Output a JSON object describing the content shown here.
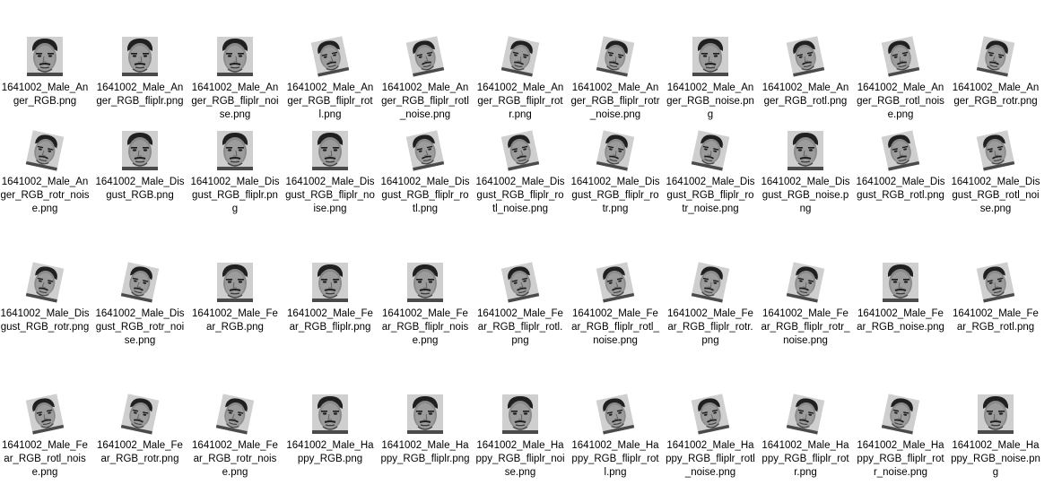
{
  "window": {
    "view": "Large icons"
  },
  "files": [
    {
      "name": "1641002_Male_Anger_RGB.png",
      "transform": "none"
    },
    {
      "name": "1641002_Male_Anger_RGB_fliplr.png",
      "transform": "fliplr"
    },
    {
      "name": "1641002_Male_Anger_RGB_fliplr_noise.png",
      "transform": "fliplr"
    },
    {
      "name": "1641002_Male_Anger_RGB_fliplr_rotl.png",
      "transform": "fliplr_rotl"
    },
    {
      "name": "1641002_Male_Anger_RGB_fliplr_rotl_noise.png",
      "transform": "fliplr_rotl"
    },
    {
      "name": "1641002_Male_Anger_RGB_fliplr_rotr.png",
      "transform": "fliplr_rotr"
    },
    {
      "name": "1641002_Male_Anger_RGB_fliplr_rotr_noise.png",
      "transform": "fliplr_rotr"
    },
    {
      "name": "1641002_Male_Anger_RGB_noise.png",
      "transform": "none"
    },
    {
      "name": "1641002_Male_Anger_RGB_rotl.png",
      "transform": "rotl"
    },
    {
      "name": "1641002_Male_Anger_RGB_rotl_noise.png",
      "transform": "rotl"
    },
    {
      "name": "1641002_Male_Anger_RGB_rotr.png",
      "transform": "rotr"
    },
    {
      "name": "1641002_Male_Anger_RGB_rotr_noise.png",
      "transform": "rotr"
    },
    {
      "name": "1641002_Male_Disgust_RGB.png",
      "transform": "none"
    },
    {
      "name": "1641002_Male_Disgust_RGB_fliplr.png",
      "transform": "fliplr"
    },
    {
      "name": "1641002_Male_Disgust_RGB_fliplr_noise.png",
      "transform": "fliplr"
    },
    {
      "name": "1641002_Male_Disgust_RGB_fliplr_rotl.png",
      "transform": "fliplr_rotl"
    },
    {
      "name": "1641002_Male_Disgust_RGB_fliplr_rotl_noise.png",
      "transform": "fliplr_rotl"
    },
    {
      "name": "1641002_Male_Disgust_RGB_fliplr_rotr.png",
      "transform": "fliplr_rotr"
    },
    {
      "name": "1641002_Male_Disgust_RGB_fliplr_rotr_noise.png",
      "transform": "fliplr_rotr"
    },
    {
      "name": "1641002_Male_Disgust_RGB_noise.png",
      "transform": "none"
    },
    {
      "name": "1641002_Male_Disgust_RGB_rotl.png",
      "transform": "rotl"
    },
    {
      "name": "1641002_Male_Disgust_RGB_rotl_noise.png",
      "transform": "rotl"
    },
    {
      "name": "1641002_Male_Disgust_RGB_rotr.png",
      "transform": "rotr"
    },
    {
      "name": "1641002_Male_Disgust_RGB_rotr_noise.png",
      "transform": "rotr"
    },
    {
      "name": "1641002_Male_Fear_RGB.png",
      "transform": "none"
    },
    {
      "name": "1641002_Male_Fear_RGB_fliplr.png",
      "transform": "fliplr"
    },
    {
      "name": "1641002_Male_Fear_RGB_fliplr_noise.png",
      "transform": "fliplr"
    },
    {
      "name": "1641002_Male_Fear_RGB_fliplr_rotl.png",
      "transform": "fliplr_rotl"
    },
    {
      "name": "1641002_Male_Fear_RGB_fliplr_rotl_noise.png",
      "transform": "fliplr_rotl"
    },
    {
      "name": "1641002_Male_Fear_RGB_fliplr_rotr.png",
      "transform": "fliplr_rotr"
    },
    {
      "name": "1641002_Male_Fear_RGB_fliplr_rotr_noise.png",
      "transform": "fliplr_rotr"
    },
    {
      "name": "1641002_Male_Fear_RGB_noise.png",
      "transform": "none"
    },
    {
      "name": "1641002_Male_Fear_RGB_rotl.png",
      "transform": "rotl"
    },
    {
      "name": "1641002_Male_Fear_RGB_rotl_noise.png",
      "transform": "rotl"
    },
    {
      "name": "1641002_Male_Fear_RGB_rotr.png",
      "transform": "rotr"
    },
    {
      "name": "1641002_Male_Fear_RGB_rotr_noise.png",
      "transform": "rotr"
    },
    {
      "name": "1641002_Male_Happy_RGB.png",
      "transform": "none"
    },
    {
      "name": "1641002_Male_Happy_RGB_fliplr.png",
      "transform": "fliplr"
    },
    {
      "name": "1641002_Male_Happy_RGB_fliplr_noise.png",
      "transform": "fliplr"
    },
    {
      "name": "1641002_Male_Happy_RGB_fliplr_rotl.png",
      "transform": "fliplr_rotl"
    },
    {
      "name": "1641002_Male_Happy_RGB_fliplr_rotl_noise.png",
      "transform": "fliplr_rotl"
    },
    {
      "name": "1641002_Male_Happy_RGB_fliplr_rotr.png",
      "transform": "fliplr_rotr"
    },
    {
      "name": "1641002_Male_Happy_RGB_fliplr_rotr_noise.png",
      "transform": "fliplr_rotr"
    },
    {
      "name": "1641002_Male_Happy_RGB_noise.png",
      "transform": "none"
    }
  ]
}
